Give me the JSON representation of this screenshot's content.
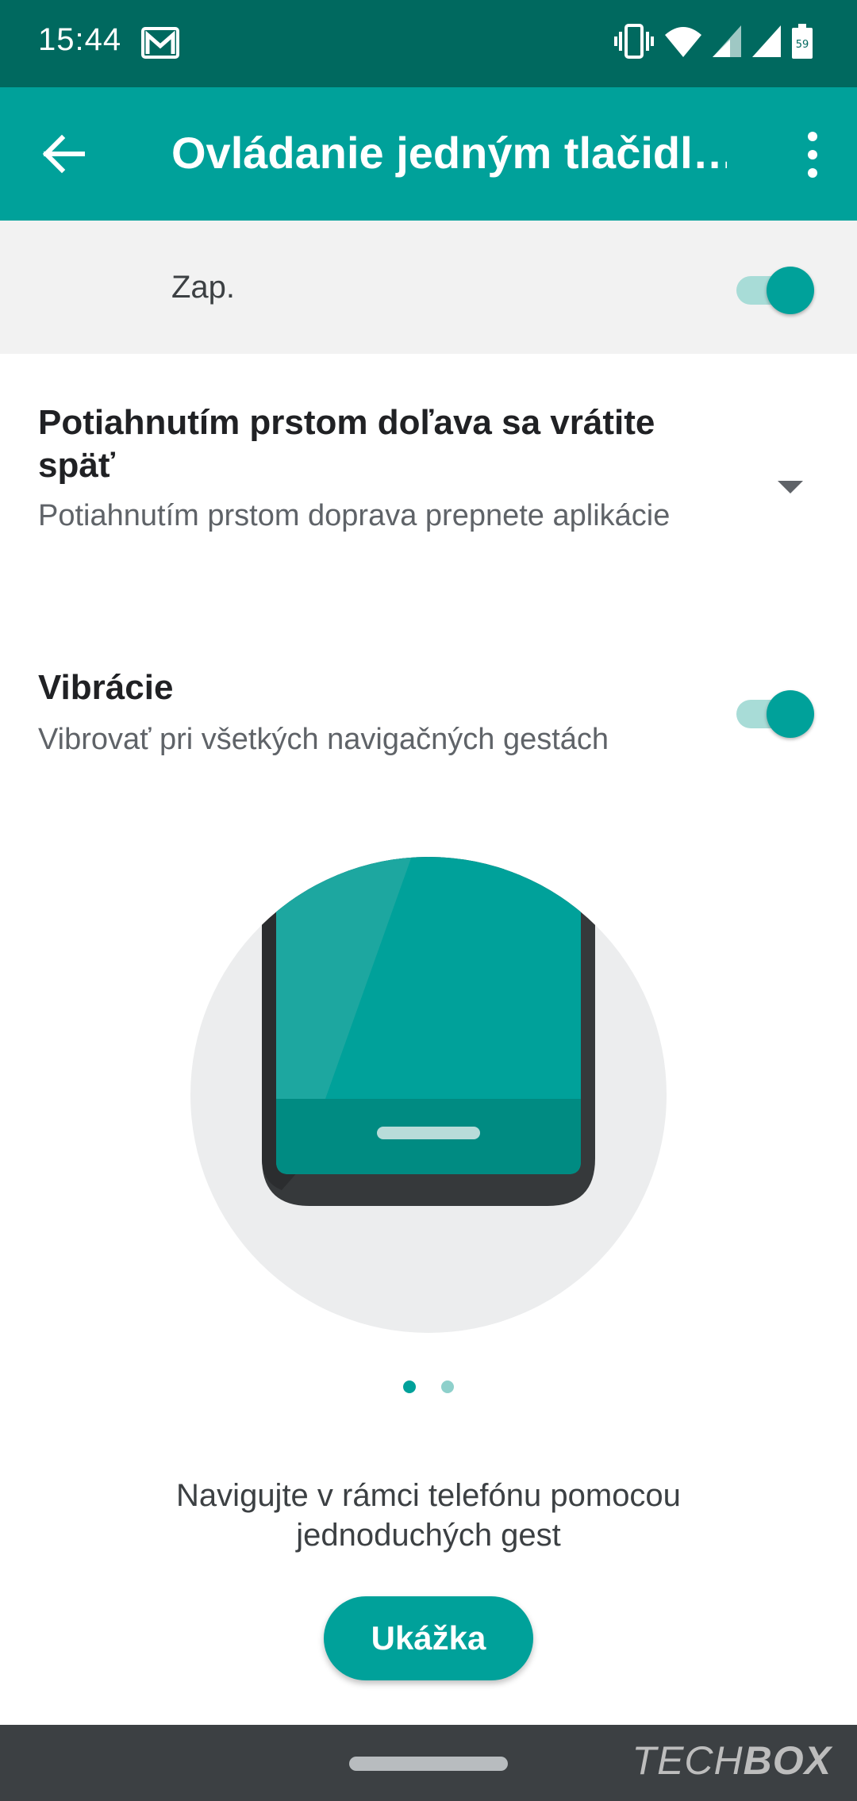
{
  "status_bar": {
    "time": "15:44",
    "battery_level": "59",
    "icons": [
      "gmail-icon",
      "vibrate-icon",
      "wifi-icon",
      "signal-icon",
      "signal-icon",
      "battery-icon"
    ]
  },
  "app_bar": {
    "title": "Ovládanie jedným tlačidl…",
    "back_icon": "arrow-back-icon",
    "more_icon": "more-vert-icon"
  },
  "master_switch": {
    "label": "Zap.",
    "enabled": true
  },
  "gesture_setting": {
    "title": "Potiahnutím prstom doľava sa vrátite späť",
    "subtitle": "Potiahnutím prstom doprava prepnete aplikácie",
    "icon": "dropdown-arrow-icon"
  },
  "vibration_setting": {
    "title": "Vibrácie",
    "subtitle": "Vibrovať pri všetkých navigačných gestách",
    "enabled": true
  },
  "pager": {
    "total": 2,
    "active": 1
  },
  "caption": "Navigujte v rámci telefónu pomocou jednoduchých gest",
  "demo_button": {
    "label": "Ukážka"
  },
  "watermark": {
    "light": "TECH",
    "bold": "BOX"
  },
  "colors": {
    "status_bar": "#00695f",
    "accent": "#00a19a",
    "track": "#a8dcd7",
    "nav_bar": "#3c4043"
  }
}
